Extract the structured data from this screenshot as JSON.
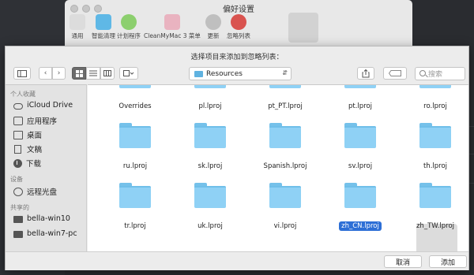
{
  "prefs": {
    "title": "偏好设置",
    "toolbar": [
      {
        "label": "通用",
        "icon": "switch-icon",
        "color": "#dcdcdc"
      },
      {
        "label": "智能清理",
        "icon": "monitor-icon",
        "color": "#5fb8e6"
      },
      {
        "label": "计划程序",
        "icon": "check-icon",
        "color": "#8ccf6e"
      },
      {
        "label": "CleanMyMac 3 菜单",
        "icon": "app-icon",
        "color": "#e9b3c0"
      },
      {
        "label": "更新",
        "icon": "download-icon",
        "color": "#bfbfbf"
      },
      {
        "label": "忽略列表",
        "icon": "no-entry-icon",
        "color": "#d9534f"
      }
    ]
  },
  "sheet": {
    "title": "选择项目来添加到忽略列表：",
    "path": "Resources",
    "search_placeholder": "搜索"
  },
  "sidebar": {
    "favorites_head": "个人收藏",
    "favorites": [
      {
        "label": "iCloud Drive",
        "icon": "cloud-icon"
      },
      {
        "label": "应用程序",
        "icon": "applications-icon"
      },
      {
        "label": "桌面",
        "icon": "desktop-icon"
      },
      {
        "label": "文稿",
        "icon": "document-icon"
      },
      {
        "label": "下载",
        "icon": "download-icon"
      }
    ],
    "devices_head": "设备",
    "devices": [
      {
        "label": "远程光盘",
        "icon": "disc-icon"
      }
    ],
    "shared_head": "共享的",
    "shared": [
      {
        "label": "bella-win10",
        "icon": "computer-icon"
      },
      {
        "label": "bella-win7-pc",
        "icon": "computer-icon"
      }
    ]
  },
  "files": [
    {
      "name": "Overrides",
      "partial": true
    },
    {
      "name": "pl.lproj",
      "partial": true
    },
    {
      "name": "pt_PT.lproj",
      "partial": true
    },
    {
      "name": "pt.lproj",
      "partial": true
    },
    {
      "name": "ro.lproj",
      "partial": true
    },
    {
      "name": "ru.lproj"
    },
    {
      "name": "sk.lproj"
    },
    {
      "name": "Spanish.lproj"
    },
    {
      "name": "sv.lproj"
    },
    {
      "name": "th.lproj"
    },
    {
      "name": "tr.lproj"
    },
    {
      "name": "uk.lproj"
    },
    {
      "name": "vi.lproj"
    },
    {
      "name": "zh_CN.lproj",
      "selected": true
    },
    {
      "name": "zh_TW.lproj"
    }
  ],
  "buttons": {
    "cancel": "取消",
    "add": "添加"
  },
  "colors": {
    "selection": "#2d6fd6",
    "folder": "#8fd1f5"
  }
}
